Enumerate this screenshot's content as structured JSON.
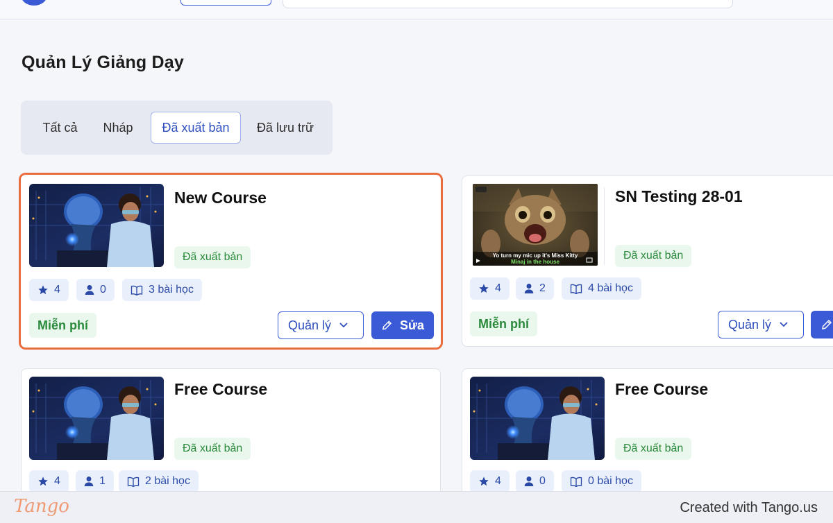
{
  "page": {
    "title": "Quản Lý Giảng Dạy"
  },
  "tabs": [
    {
      "label": "Tất cả"
    },
    {
      "label": "Nháp"
    },
    {
      "label": "Đã xuất bản"
    },
    {
      "label": "Đã lưu trữ"
    }
  ],
  "active_tab": "Đã xuất bản",
  "courses": [
    {
      "title": "New Course",
      "status": "Đã xuất bản",
      "rating": "4",
      "students": "0",
      "lessons": "3 bài học",
      "price": "Miễn phí",
      "manage_label": "Quản lý",
      "edit_label": "Sửa",
      "thumbnail": "ai-robot-boy"
    },
    {
      "title": "SN Testing 28-01",
      "status": "Đã xuất bản",
      "rating": "4",
      "students": "2",
      "lessons": "4 bài học",
      "price": "Miễn phí",
      "manage_label": "Quản lý",
      "edit_label": "",
      "thumbnail": "cat-video",
      "video_caption_1": "Yo turn my mic up it's Miss Kitty",
      "video_caption_2": "Minaj in the house"
    },
    {
      "title": "Free Course",
      "status": "Đã xuất bản",
      "rating": "4",
      "students": "1",
      "lessons": "2 bài học",
      "thumbnail": "ai-robot-boy"
    },
    {
      "title": "Free Course",
      "status": "Đã xuất bản",
      "rating": "4",
      "students": "0",
      "lessons": "0 bài học",
      "thumbnail": "ai-robot-boy"
    }
  ],
  "footer": {
    "brand": "Tango",
    "credit": "Created with Tango.us"
  },
  "colors": {
    "accent": "#3b5bd6",
    "highlight": "#ea6d3e",
    "success": "#2a8a3c"
  }
}
